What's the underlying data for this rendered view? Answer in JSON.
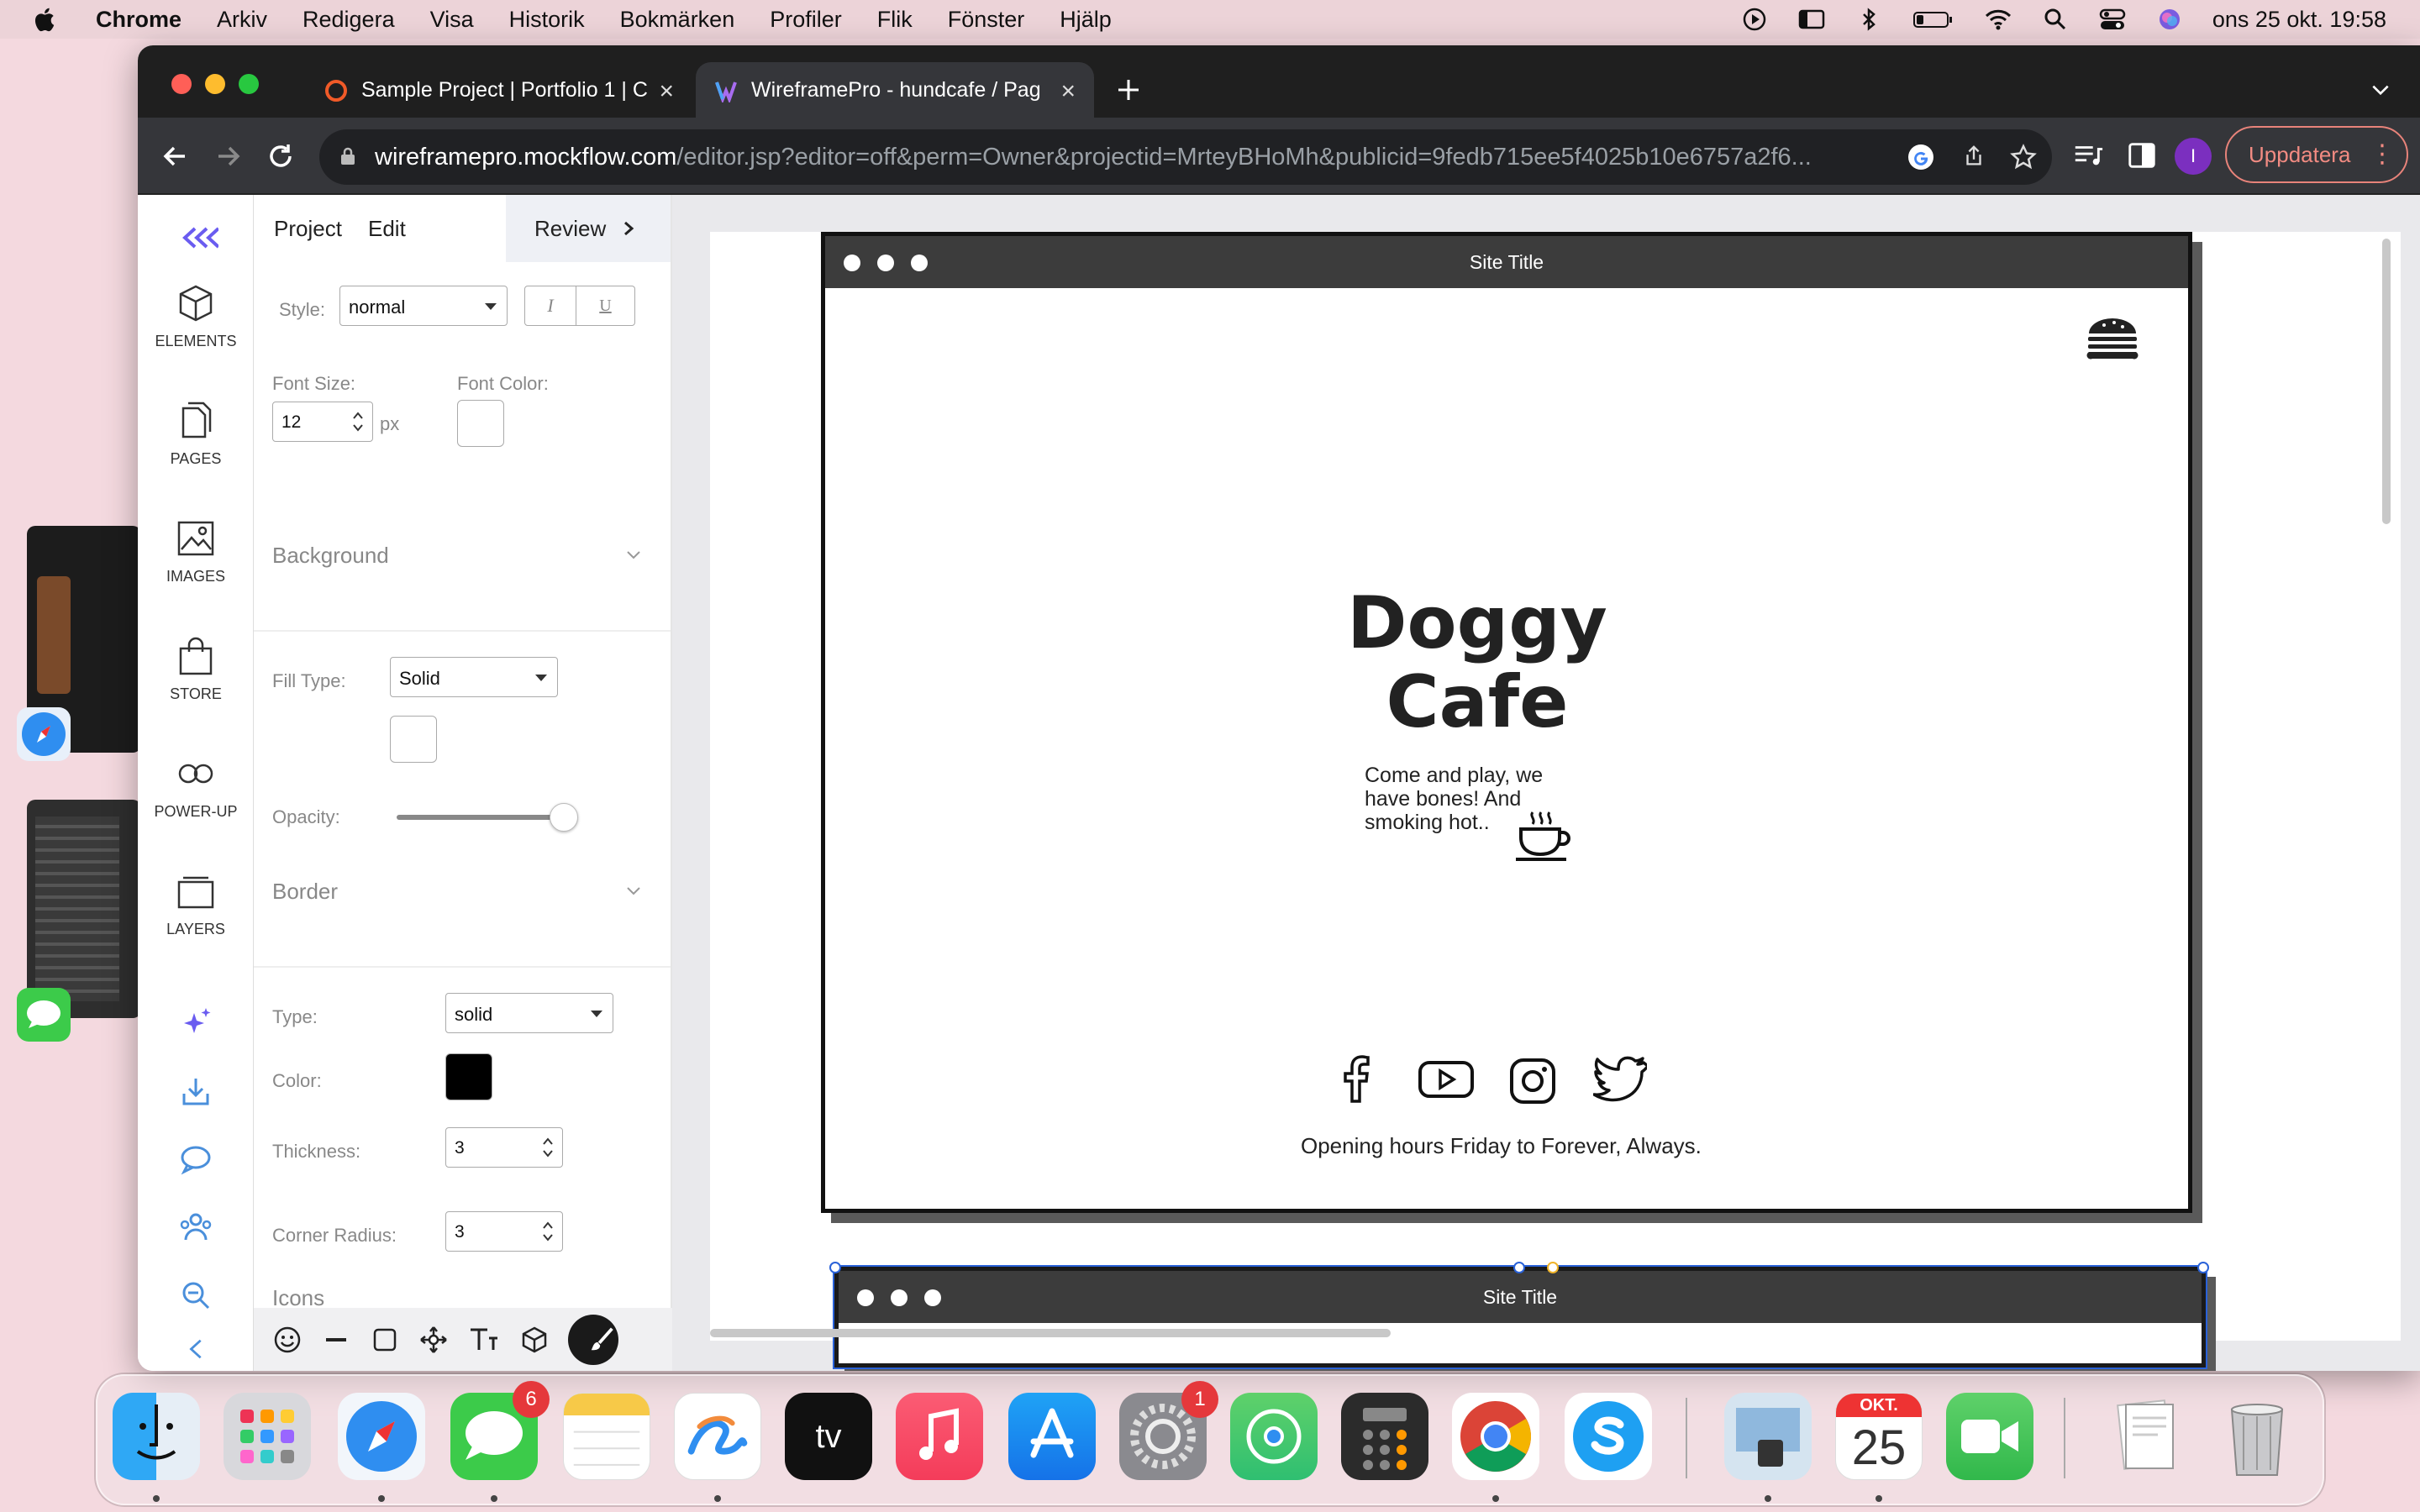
{
  "menubar": {
    "app": "Chrome",
    "items": [
      "Arkiv",
      "Redigera",
      "Visa",
      "Historik",
      "Bokmärken",
      "Profiler",
      "Flik",
      "Fönster",
      "Hjälp"
    ],
    "datetime": "ons 25 okt. 19:58"
  },
  "browser": {
    "tabs": [
      {
        "title": "Sample Project | Portfolio 1 | C",
        "active": false
      },
      {
        "title": "WireframePro - hundcafe / Pag",
        "active": true
      }
    ],
    "url_host": "wireframepro.mockflow.com",
    "url_path": "/editor.jsp?editor=off&perm=Owner&projectid=MrteyBHoMh&publicid=9fedb715ee5f4025b10e6757a2f6...",
    "update_label": "Uppdatera",
    "profile_initial": "I"
  },
  "iconbar": {
    "items": [
      "ELEMENTS",
      "PAGES",
      "IMAGES",
      "STORE",
      "POWER-UP",
      "LAYERS"
    ]
  },
  "panel": {
    "tabs": {
      "project": "Project",
      "edit": "Edit",
      "review": "Review"
    },
    "style_label": "Style:",
    "style_value": "normal",
    "italic": "I",
    "underline": "U",
    "font_size_label": "Font Size:",
    "font_size_value": "12",
    "font_size_unit": "px",
    "font_color_label": "Font Color:",
    "background_title": "Background",
    "fill_type_label": "Fill Type:",
    "fill_type_value": "Solid",
    "opacity_label": "Opacity:",
    "opacity_value": 1.0,
    "border_title": "Border",
    "border_type_label": "Type:",
    "border_type_value": "solid",
    "border_color_label": "Color:",
    "border_color": "#000000",
    "thickness_label": "Thickness:",
    "thickness_value": "3",
    "radius_label": "Corner Radius:",
    "radius_value": "3",
    "icons_title": "Icons"
  },
  "canvas": {
    "frame1_title": "Site Title",
    "frame2_title": "Site Title",
    "headline_line1": "Doggy",
    "headline_line2": "Cafe",
    "tagline": "Come and play, we have bones! And smoking hot..",
    "hours": "Opening hours Friday to Forever, Always."
  },
  "dock": {
    "messages_badge": "6",
    "settings_badge": "1",
    "calendar_month": "OKT.",
    "calendar_day": "25"
  }
}
